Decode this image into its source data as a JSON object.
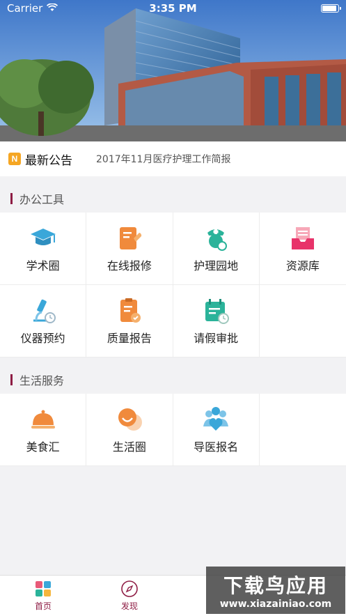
{
  "status_bar": {
    "carrier": "Carrier",
    "time": "3:35 PM"
  },
  "notice": {
    "badge": "N",
    "title": "最新公告",
    "text": "2017年11月医疗护理工作简报"
  },
  "office_tools": {
    "title": "办公工具",
    "items": [
      {
        "label": "学术圈",
        "icon": "graduation-cap-icon"
      },
      {
        "label": "在线报修",
        "icon": "repair-document-icon"
      },
      {
        "label": "护理园地",
        "icon": "nurse-icon"
      },
      {
        "label": "资源库",
        "icon": "resource-inbox-icon"
      },
      {
        "label": "仪器预约",
        "icon": "microscope-clock-icon"
      },
      {
        "label": "质量报告",
        "icon": "quality-report-icon"
      },
      {
        "label": "请假审批",
        "icon": "leave-calendar-icon"
      }
    ]
  },
  "life_services": {
    "title": "生活服务",
    "items": [
      {
        "label": "美食汇",
        "icon": "food-cloche-icon"
      },
      {
        "label": "生活圈",
        "icon": "life-circle-icon"
      },
      {
        "label": "导医报名",
        "icon": "people-heart-icon"
      }
    ]
  },
  "tab_bar": {
    "tabs": [
      {
        "label": "首页",
        "icon": "home-grid-icon"
      },
      {
        "label": "发现",
        "icon": "compass-icon"
      }
    ]
  },
  "watermark": {
    "top": "下载鸟应用",
    "bottom": "www.xiazainiao.com"
  },
  "colors": {
    "accent": "#8e1c44",
    "badge": "#f5a623"
  }
}
